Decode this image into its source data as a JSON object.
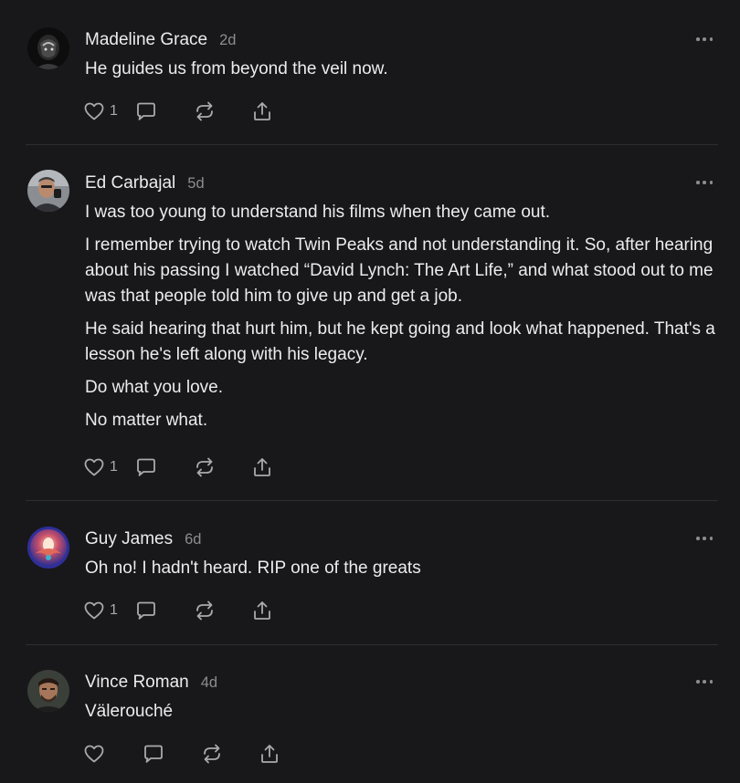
{
  "colors": {
    "background": "#18181a",
    "text": "#ececee",
    "muted": "#8c8c92",
    "icon": "#a9a9ae",
    "divider": "#2e2e31"
  },
  "icons": {
    "like": "heart-icon",
    "reply": "comment-bubble-icon",
    "restack": "restack-icon",
    "share": "share-icon",
    "more": "more-options-icon"
  },
  "comments": [
    {
      "author": "Madeline Grace",
      "time": "2d",
      "paragraphs": [
        "He guides us from beyond the veil now."
      ],
      "likes": "1"
    },
    {
      "author": "Ed Carbajal",
      "time": "5d",
      "paragraphs": [
        "I was too young to understand his films when they came out.",
        "I remember trying to watch Twin Peaks and not understanding it. So, after hearing about his passing I watched “David Lynch: The Art Life,” and what stood out to me was that people told him to give up and get a job.",
        "He said hearing that hurt him, but he kept going and look what happened. That's a lesson he's left along with his legacy.",
        "Do what you love.",
        "No matter what."
      ],
      "likes": "1"
    },
    {
      "author": "Guy James",
      "time": "6d",
      "paragraphs": [
        "Oh no! I hadn't heard. RIP one of the greats"
      ],
      "likes": "1"
    },
    {
      "author": "Vince Roman",
      "time": "4d",
      "paragraphs": [
        "Välerouché"
      ],
      "likes": ""
    }
  ]
}
